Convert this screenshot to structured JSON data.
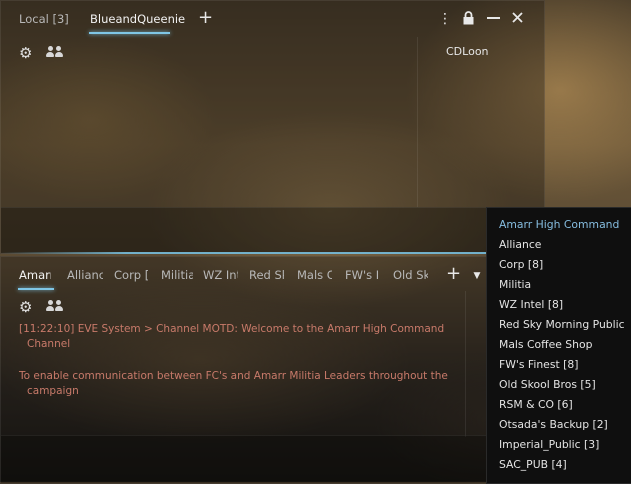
{
  "top_window": {
    "tabs": [
      {
        "label": "Local [3]",
        "active": false
      },
      {
        "label": "BlueandQueenie",
        "active": true
      }
    ],
    "members": [
      "CDLoon"
    ]
  },
  "bottom_window": {
    "tabs": [
      {
        "label": "Amarr",
        "active": true
      },
      {
        "label": "Allianc",
        "active": false
      },
      {
        "label": "Corp [",
        "active": false
      },
      {
        "label": "Militia",
        "active": false
      },
      {
        "label": "WZ Int",
        "active": false
      },
      {
        "label": "Red Sk",
        "active": false
      },
      {
        "label": "Mals C",
        "active": false
      },
      {
        "label": "FW's I",
        "active": false
      },
      {
        "label": "Old Sk",
        "active": false
      }
    ],
    "messages": [
      {
        "line1": "[11:22:10] EVE System > Channel MOTD: Welcome to the Amarr High Command",
        "line2": "Channel"
      },
      {
        "line1": "To enable communication between FC's and Amarr Militia Leaders throughout the",
        "line2": "campaign"
      }
    ]
  },
  "channel_dropdown": {
    "items": [
      "Amarr High Command",
      "Alliance",
      "Corp [8]",
      "Militia",
      "WZ Intel [8]",
      "Red Sky Morning Public",
      "Mals Coffee Shop",
      "FW's Finest [8]",
      "Old Skool Bros [5]",
      "RSM & CO [6]",
      "Otsada's Backup [2]",
      "Imperial_Public [3]",
      "SAC_PUB [4]"
    ],
    "selected_index": 0
  },
  "colors": {
    "accent": "#7fc6e6",
    "system_message": "#c87a6a",
    "dropdown_selected": "#86bde0"
  }
}
